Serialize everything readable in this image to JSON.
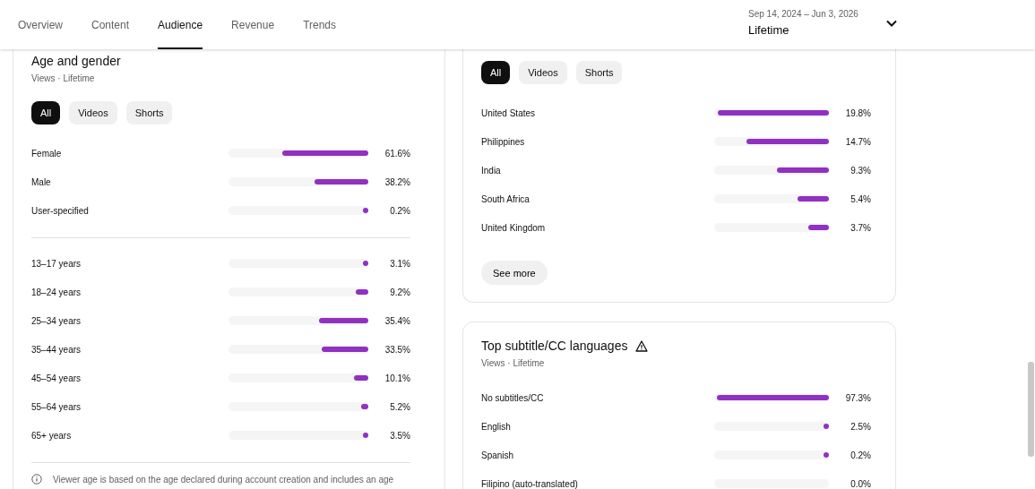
{
  "tabs": [
    {
      "label": "Overview",
      "selected": false
    },
    {
      "label": "Content",
      "selected": false
    },
    {
      "label": "Audience",
      "selected": true
    },
    {
      "label": "Revenue",
      "selected": false
    },
    {
      "label": "Trends",
      "selected": false
    }
  ],
  "date_range": {
    "range": "Sep 14, 2024 – Jun 3, 2026",
    "period": "Lifetime"
  },
  "age_gender": {
    "title": "Age and gender",
    "subtitle": "Views · Lifetime",
    "filters": [
      {
        "label": "All",
        "selected": true
      },
      {
        "label": "Videos",
        "selected": false
      },
      {
        "label": "Shorts",
        "selected": false
      }
    ],
    "gender_rows": [
      {
        "label": "Female",
        "level": 0.616,
        "value": "61.6%"
      },
      {
        "label": "Male",
        "level": 0.382,
        "value": "38.2%"
      },
      {
        "label": "User-specified",
        "level": 0.002,
        "value": "0.2%"
      }
    ],
    "age_rows": [
      {
        "label": "13–17 years",
        "level": 0.031,
        "value": "3.1%"
      },
      {
        "label": "18–24 years",
        "level": 0.092,
        "value": "9.2%"
      },
      {
        "label": "25–34 years",
        "level": 0.354,
        "value": "35.4%"
      },
      {
        "label": "35–44 years",
        "level": 0.335,
        "value": "33.5%"
      },
      {
        "label": "45–54 years",
        "level": 0.101,
        "value": "10.1%"
      },
      {
        "label": "55–64 years",
        "level": 0.052,
        "value": "5.2%"
      },
      {
        "label": "65+ years",
        "level": 0.035,
        "value": "3.5%"
      }
    ],
    "note": "Viewer age is based on the age declared during account creation and includes an age"
  },
  "geography": {
    "filters": [
      {
        "label": "All",
        "selected": true
      },
      {
        "label": "Videos",
        "selected": false
      },
      {
        "label": "Shorts",
        "selected": false
      }
    ],
    "rows": [
      {
        "label": "United States",
        "level": 0.97,
        "value": "19.8%"
      },
      {
        "label": "Philippines",
        "level": 0.72,
        "value": "14.7%"
      },
      {
        "label": "India",
        "level": 0.45,
        "value": "9.3%"
      },
      {
        "label": "South Africa",
        "level": 0.27,
        "value": "5.4%"
      },
      {
        "label": "United Kingdom",
        "level": 0.18,
        "value": "3.7%"
      }
    ],
    "see_more": "See more"
  },
  "subtitles": {
    "title": "Top subtitle/CC languages",
    "subtitle": "Views · Lifetime",
    "rows": [
      {
        "label": "No subtitles/CC",
        "level": 0.973,
        "value": "97.3%"
      },
      {
        "label": "English",
        "level": 0.025,
        "value": "2.5%"
      },
      {
        "label": "Spanish",
        "level": 0.002,
        "value": "0.2%"
      },
      {
        "label": "Filipino (auto-translated)",
        "value": "0.0%"
      }
    ]
  }
}
